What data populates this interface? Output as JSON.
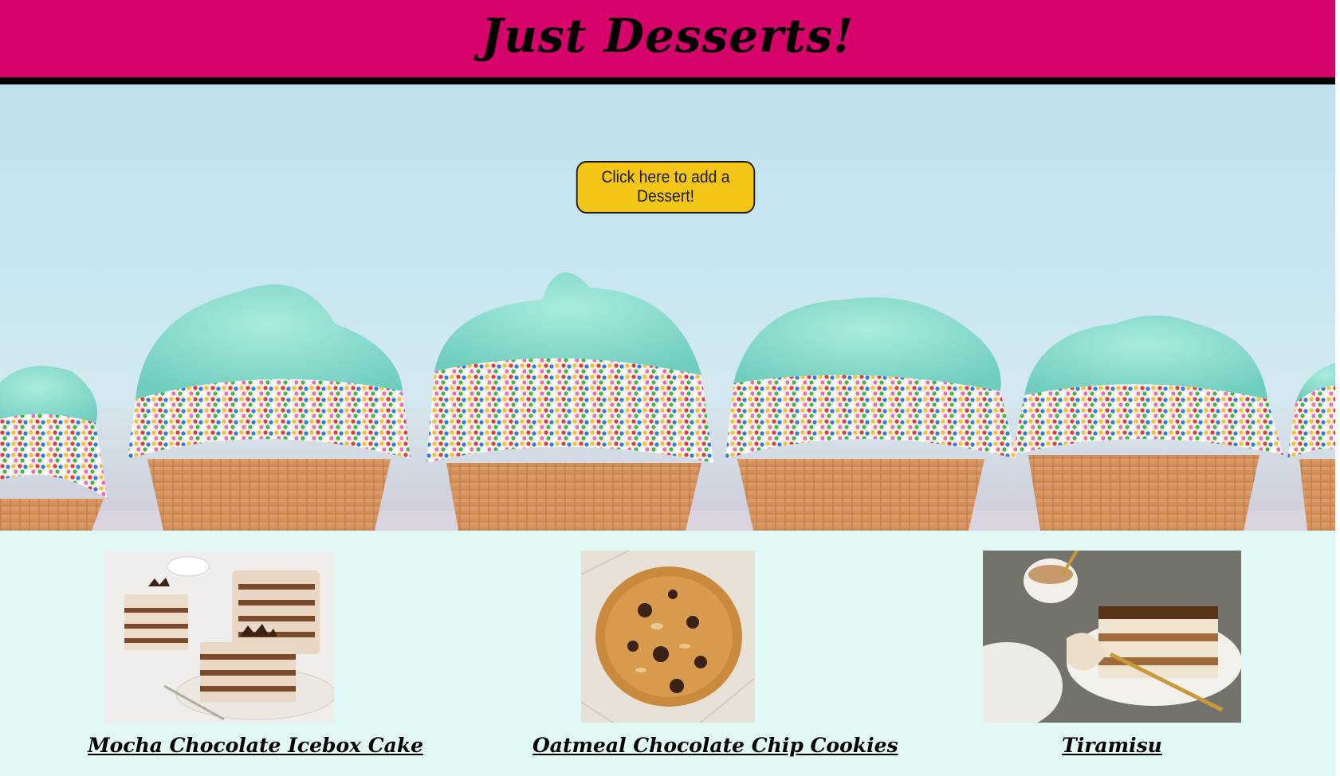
{
  "header": {
    "title": "Just Desserts!",
    "background_color": "#d6036b"
  },
  "hero": {
    "image_icon": "cupcakes-banner-image",
    "add_button_label": "Click here to add a Dessert!",
    "button_color": "#f3c517"
  },
  "gallery": {
    "background_color": "#e1f8f5",
    "items": [
      {
        "label": "Mocha Chocolate Icebox Cake",
        "image_icon": "icebox-cake-photo"
      },
      {
        "label": "Oatmeal Chocolate Chip Cookies",
        "image_icon": "cookie-photo"
      },
      {
        "label": "Tiramisu",
        "image_icon": "tiramisu-photo"
      }
    ]
  }
}
